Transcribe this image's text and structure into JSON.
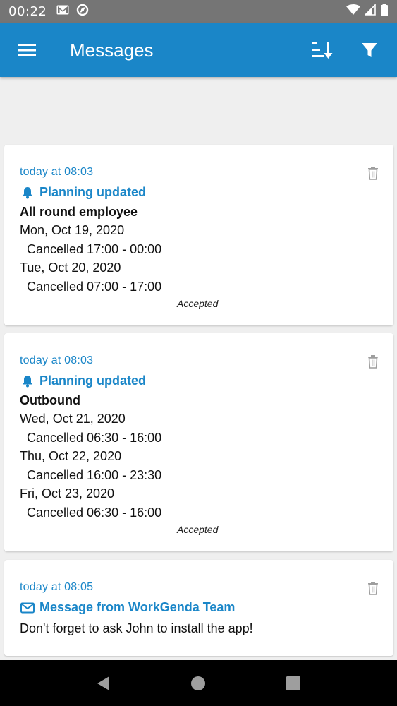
{
  "status_bar": {
    "time": "00:22",
    "icons": [
      "gmail-icon",
      "sync-icon",
      "wifi-icon",
      "signal-icon",
      "battery-icon"
    ]
  },
  "app_bar": {
    "title": "Messages",
    "background": "#1a86c8",
    "actions": [
      "sort-icon",
      "filter-icon"
    ]
  },
  "messages": [
    {
      "timestamp": "today at 08:03",
      "icon": "bell-icon",
      "heading": "Planning updated",
      "subject": "All round employee",
      "entries": [
        {
          "date": "Mon, Oct 19, 2020",
          "detail": "Cancelled 17:00 - 00:00"
        },
        {
          "date": "Tue, Oct 20, 2020",
          "detail": "Cancelled 07:00 - 17:00"
        }
      ],
      "status": "Accepted"
    },
    {
      "timestamp": "today at 08:03",
      "icon": "bell-icon",
      "heading": "Planning updated",
      "subject": "Outbound",
      "entries": [
        {
          "date": "Wed, Oct 21, 2020",
          "detail": "Cancelled 06:30 - 16:00"
        },
        {
          "date": "Thu, Oct 22, 2020",
          "detail": "Cancelled 16:00 - 23:30"
        },
        {
          "date": "Fri, Oct 23, 2020",
          "detail": "Cancelled 06:30 - 16:00"
        }
      ],
      "status": "Accepted"
    },
    {
      "timestamp": "today at 08:05",
      "icon": "envelope-icon",
      "heading": "Message from WorkGenda Team",
      "body": "Don't forget to ask John to install the app!"
    }
  ],
  "colors": {
    "accent": "#1a86c8",
    "background": "#efefef",
    "status_bar": "#757575"
  }
}
